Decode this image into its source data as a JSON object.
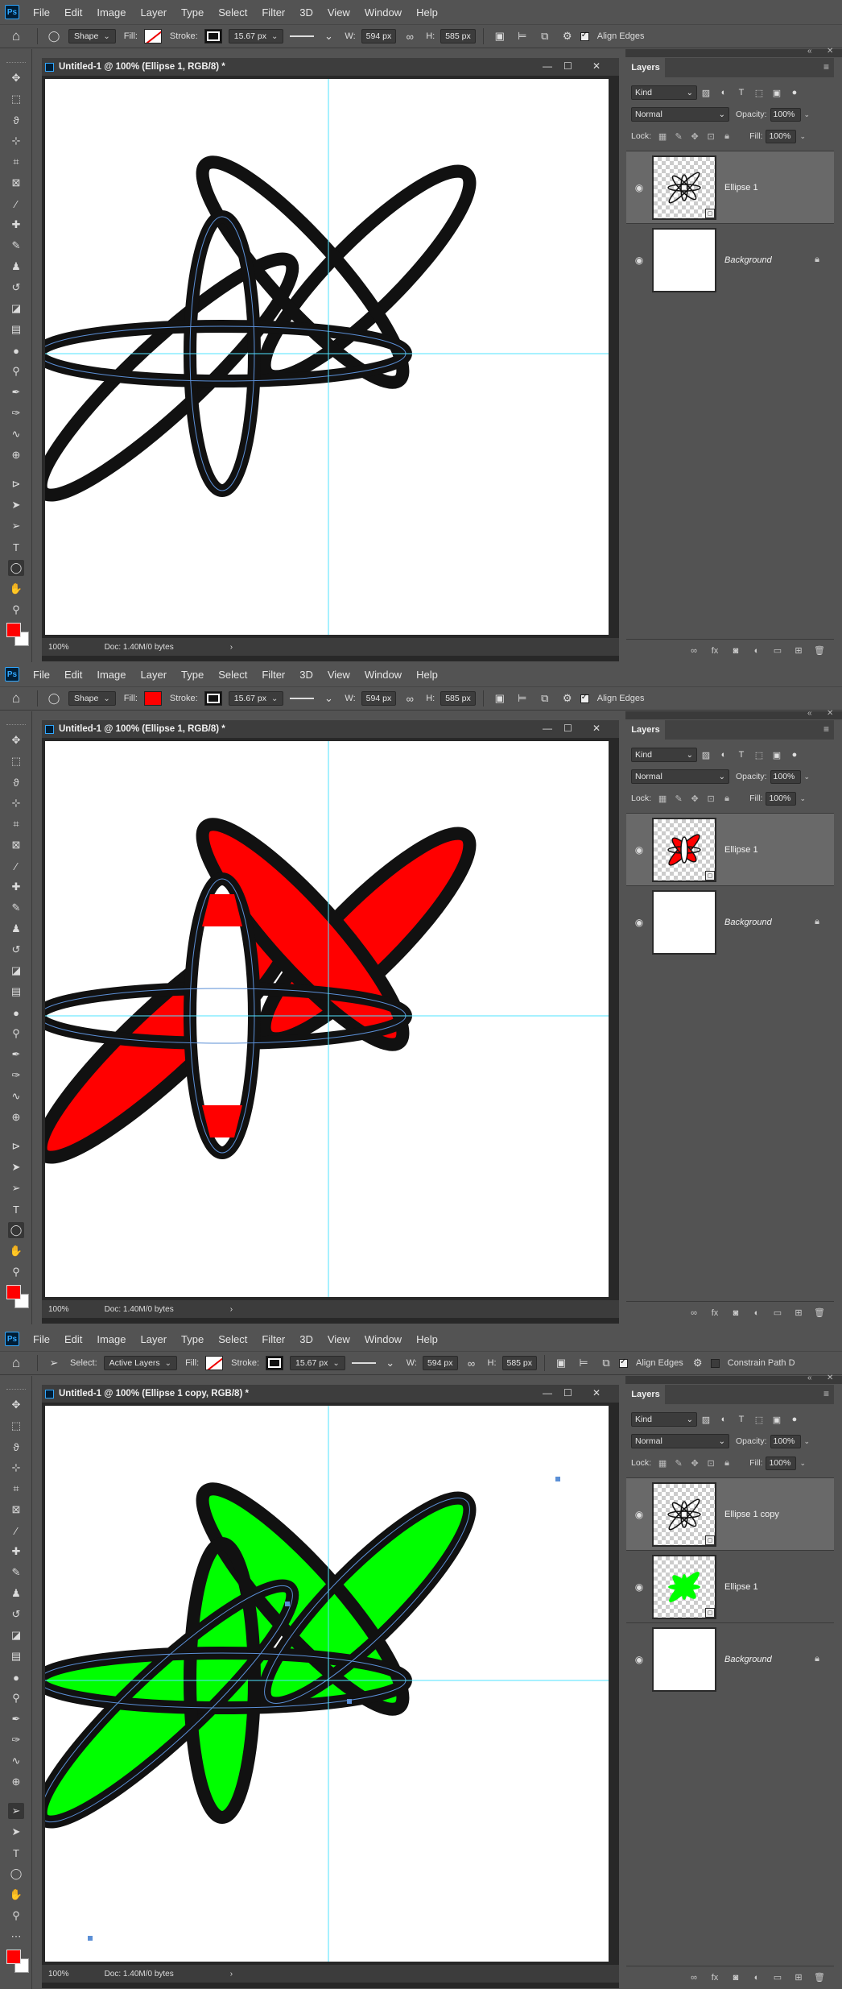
{
  "menu": [
    "File",
    "Edit",
    "Image",
    "Layer",
    "Type",
    "Select",
    "Filter",
    "3D",
    "View",
    "Window",
    "Help"
  ],
  "ps_logo": "Ps",
  "colors": {
    "red": "#ff0000",
    "green": "#00ff00",
    "stroke": "#111111",
    "guide": "#4fe3ff",
    "path": "#5b8fd6"
  },
  "options_shape": {
    "mode": "Shape",
    "fill_label": "Fill:",
    "stroke_label": "Stroke:",
    "stroke_width": "15.67 px",
    "w_label": "W:",
    "w_value": "594 px",
    "h_label": "H:",
    "h_value": "585 px",
    "align_edges": "Align Edges"
  },
  "options_select": {
    "select_label": "Select:",
    "select_value": "Active Layers",
    "fill_label": "Fill:",
    "stroke_label": "Stroke:",
    "stroke_width": "15.67 px",
    "w_label": "W:",
    "w_value": "594 px",
    "h_label": "H:",
    "h_value": "585 px",
    "align_edges": "Align Edges",
    "constrain": "Constrain Path D"
  },
  "doc_titles": [
    "Untitled-1 @ 100% (Ellipse 1, RGB/8) *",
    "Untitled-1 @ 100% (Ellipse 1, RGB/8) *",
    "Untitled-1 @ 100% (Ellipse 1 copy, RGB/8) *"
  ],
  "status": {
    "zoom": "100%",
    "doc": "Doc: 1.40M/0 bytes"
  },
  "layers_panel": {
    "tab": "Layers",
    "kind": "Kind",
    "blend": "Normal",
    "opacity_label": "Opacity:",
    "opacity": "100%",
    "lock_label": "Lock:",
    "fill_label": "Fill:",
    "fill": "100%"
  },
  "layer_names": {
    "ellipse1": "Ellipse 1",
    "ellipse1copy": "Ellipse 1 copy",
    "background": "Background"
  }
}
